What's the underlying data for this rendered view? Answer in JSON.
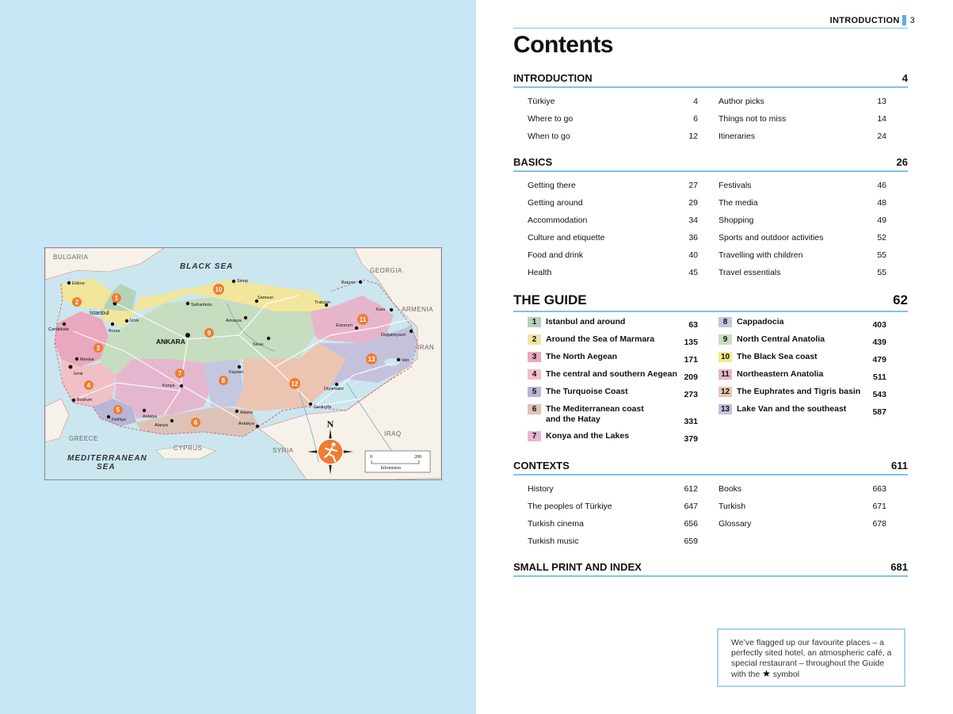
{
  "running_head": {
    "label": "INTRODUCTION",
    "page": "3"
  },
  "title": "Contents",
  "map": {
    "labels": {
      "bulgaria": "BULGARIA",
      "black_sea": "BLACK SEA",
      "georgia": "GEORGIA",
      "armenia": "ARMENIA",
      "iran": "IRAN",
      "iraq": "IRAQ",
      "syria": "SYRIA",
      "cyprus": "CYPRUS",
      "greece": "GREECE",
      "med1": "MEDITERRANEAN",
      "med2": "SEA",
      "ankara": "ANKARA",
      "istanbul": "İstanbul",
      "edirne": "Edirne",
      "canakkale": "Çanakkale",
      "izmir": "İzmir",
      "manisa": "Manisa",
      "bursa": "Bursa",
      "iznik": "İznik",
      "bodrum": "Bodrum",
      "fethiye": "Fethiye",
      "antalya": "Antalya",
      "alanya": "Alanya",
      "konya": "Konya",
      "safranbolu": "Safranbolu",
      "sinop": "Sinop",
      "samsun": "Samsun",
      "amasya": "Amasya",
      "sivas": "Sivas",
      "kayseri": "Kayseri",
      "adana": "Adana",
      "antakya": "Antakya",
      "sanliurfa": "Şanlıurfa",
      "diyarbakir": "Diyarbakır",
      "trabzon": "Trabzon",
      "batumi": "Batumi",
      "kars": "Kars",
      "erzurum": "Erzurum",
      "dogubeyazit": "Doğubeyazıt",
      "van": "Van"
    },
    "scale": {
      "zero": "0",
      "max": "200",
      "unit": "kilometres"
    },
    "north": "N"
  },
  "sections": {
    "introduction": {
      "title": "INTRODUCTION",
      "page": "4",
      "left": [
        {
          "label": "Türkiye",
          "page": "4"
        },
        {
          "label": "Where to go",
          "page": "6"
        },
        {
          "label": "When to go",
          "page": "12"
        }
      ],
      "right": [
        {
          "label": "Author picks",
          "page": "13"
        },
        {
          "label": "Things not to miss",
          "page": "14"
        },
        {
          "label": "Itineraries",
          "page": "24"
        }
      ]
    },
    "basics": {
      "title": "BASICS",
      "page": "26",
      "left": [
        {
          "label": "Getting there",
          "page": "27"
        },
        {
          "label": "Getting around",
          "page": "29"
        },
        {
          "label": "Accommodation",
          "page": "34"
        },
        {
          "label": "Culture and etiquette",
          "page": "36"
        },
        {
          "label": "Food and drink",
          "page": "40"
        },
        {
          "label": "Health",
          "page": "45"
        }
      ],
      "right": [
        {
          "label": "Festivals",
          "page": "46"
        },
        {
          "label": "The media",
          "page": "48"
        },
        {
          "label": "Shopping",
          "page": "49"
        },
        {
          "label": "Sports and outdoor activities",
          "page": "52"
        },
        {
          "label": "Travelling with children",
          "page": "55"
        },
        {
          "label": "Travel essentials",
          "page": "55"
        }
      ]
    },
    "guide": {
      "title": "THE GUIDE",
      "page": "62",
      "left": [
        {
          "num": "1",
          "label": "Istanbul and around",
          "page": "63",
          "color": "#b5d3b9"
        },
        {
          "num": "2",
          "label": "Around the Sea of Marmara",
          "page": "135",
          "color": "#f1e69b"
        },
        {
          "num": "3",
          "label": "The North Aegean",
          "page": "171",
          "color": "#e9a8bd"
        },
        {
          "num": "4",
          "label": "The central and southern Aegean",
          "page": "209",
          "color": "#f0c0c6"
        },
        {
          "num": "5",
          "label": "The Turquoise Coast",
          "page": "273",
          "color": "#b7b6d7"
        },
        {
          "num": "6",
          "label": "The Mediterranean coast and the Hatay",
          "page": "331",
          "color": "#ddc3b7"
        },
        {
          "num": "7",
          "label": "Konya and the Lakes",
          "page": "379",
          "color": "#e5b7cf"
        }
      ],
      "right": [
        {
          "num": "8",
          "label": "Cappadocia",
          "page": "403",
          "color": "#c4c7e0"
        },
        {
          "num": "9",
          "label": "North Central Anatolia",
          "page": "439",
          "color": "#c6ddc0"
        },
        {
          "num": "10",
          "label": "The Black Sea coast",
          "page": "479",
          "color": "#f3ea8e"
        },
        {
          "num": "11",
          "label": "Northeastern Anatolia",
          "page": "511",
          "color": "#e7b5cb"
        },
        {
          "num": "12",
          "label": "The Euphrates and Tigris basin",
          "page": "543",
          "color": "#ecc5b2"
        },
        {
          "num": "13",
          "label": "Lake Van and the southeast",
          "page": "587",
          "color": "#c3c1dc"
        }
      ]
    },
    "contexts": {
      "title": "CONTEXTS",
      "page": "611",
      "left": [
        {
          "label": "History",
          "page": "612"
        },
        {
          "label": "The peoples of Türkiye",
          "page": "647"
        },
        {
          "label": "Turkish cinema",
          "page": "656"
        },
        {
          "label": "Turkish music",
          "page": "659"
        }
      ],
      "right": [
        {
          "label": "Books",
          "page": "663"
        },
        {
          "label": "Turkish",
          "page": "671"
        },
        {
          "label": "Glossary",
          "page": "678"
        }
      ]
    },
    "small_print": {
      "title": "SMALL PRINT AND INDEX",
      "page": "681"
    }
  },
  "note": {
    "text_before": "We’ve flagged up our favourite places – a perfectly sited hotel, an atmospheric café, a special restaurant – throughout the Guide with the",
    "star": "★",
    "text_after": "symbol"
  }
}
